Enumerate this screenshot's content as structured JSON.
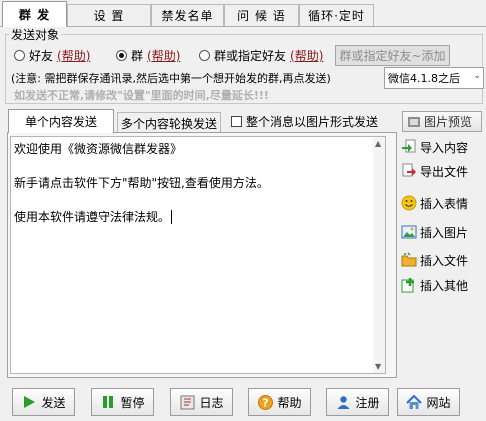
{
  "tabs": [
    {
      "label": "群 发"
    },
    {
      "label": "设 置"
    },
    {
      "label": "禁发名单"
    },
    {
      "label": "问 候 语"
    },
    {
      "label": "循环·定时"
    }
  ],
  "send_target": {
    "group_label": "发送对象",
    "radios": [
      {
        "label": "好友",
        "help": "(帮助)",
        "selected": false
      },
      {
        "label": "群",
        "help": "(帮助)",
        "selected": true
      },
      {
        "label": "群或指定好友",
        "help": "(帮助)",
        "selected": false
      }
    ],
    "add_button": "群或指定好友~添加"
  },
  "notice": {
    "line1": "(注意: 需把群保存通讯录,然后选中第一个想开始发的群,再点发送)",
    "line2": "如发送不正常,请修改\"设置\"里面的时间,尽量延长!!!",
    "version_select": "微信4.1.8之后"
  },
  "content_tabs": {
    "single": "单个内容发送",
    "multi": "多个内容轮换发送",
    "as_image_label": "整个消息以图片形式发送"
  },
  "editor": {
    "line1": "欢迎使用《微资源微信群发器》",
    "line2": "新手请点击软件下方\"帮助\"按钮,查看使用方法。",
    "line3": "使用本软件请遵守法律法规。"
  },
  "side_buttons": {
    "preview": "图片预览",
    "import": "导入内容",
    "export": "导出文件",
    "emoji": "插入表情",
    "image": "插入图片",
    "file": "插入文件",
    "other": "插入其他"
  },
  "bottom_buttons": {
    "send": "发送",
    "pause": "暂停",
    "log": "日志",
    "help": "帮助",
    "register": "注册",
    "website": "网站"
  },
  "colors": {
    "help_link": "#8b1a1a",
    "notice_gray": "#b0b0b0",
    "send_green": "#2e9b2e",
    "help_orange": "#f0a020"
  }
}
